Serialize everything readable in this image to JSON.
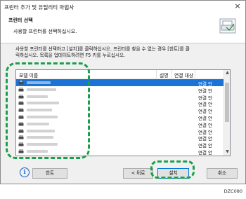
{
  "window": {
    "title": "프린터 추가 및 유틸리티 마법사",
    "close_symbol": "×"
  },
  "header": {
    "title": "프린터 선택",
    "subtitle": "사용할 프린터를 선택하십시오.",
    "icon": "printer-wizard-icon"
  },
  "instruction": {
    "line1": "사용할 프린터를 선택하고 [설치]를 클릭하십시오. 프린터를 찾을 수 없는 경우 [힌트]를 클",
    "line2": "릭하십시오. 목록을 업데이트하려면 F5 키를 누르십시오."
  },
  "list": {
    "columns": {
      "model": "모델 이름",
      "description": "설명",
      "target": "연결 대상"
    },
    "rows": [
      {
        "target": "연결 안",
        "selected": true
      },
      {
        "target": "연결 안",
        "selected": false
      },
      {
        "target": "연결 안",
        "selected": false
      },
      {
        "target": "연결 안",
        "selected": false
      },
      {
        "target": "연결 안",
        "selected": false
      },
      {
        "target": "연결 안",
        "selected": false
      },
      {
        "target": "연결 안",
        "selected": false
      },
      {
        "target": "연결 안",
        "selected": false
      },
      {
        "target": "연결 안",
        "selected": false
      },
      {
        "target": "연결 안",
        "selected": false
      },
      {
        "target": "연결 안",
        "selected": false
      }
    ]
  },
  "buttons": {
    "hint": "힌트",
    "back": "< 뒤로",
    "install": "설치",
    "cancel": "취소"
  },
  "figure_code": "DZC080",
  "colors": {
    "selection": "#1c73d6",
    "callout": "#1aa04b",
    "info_icon": "#1a5fb4"
  }
}
